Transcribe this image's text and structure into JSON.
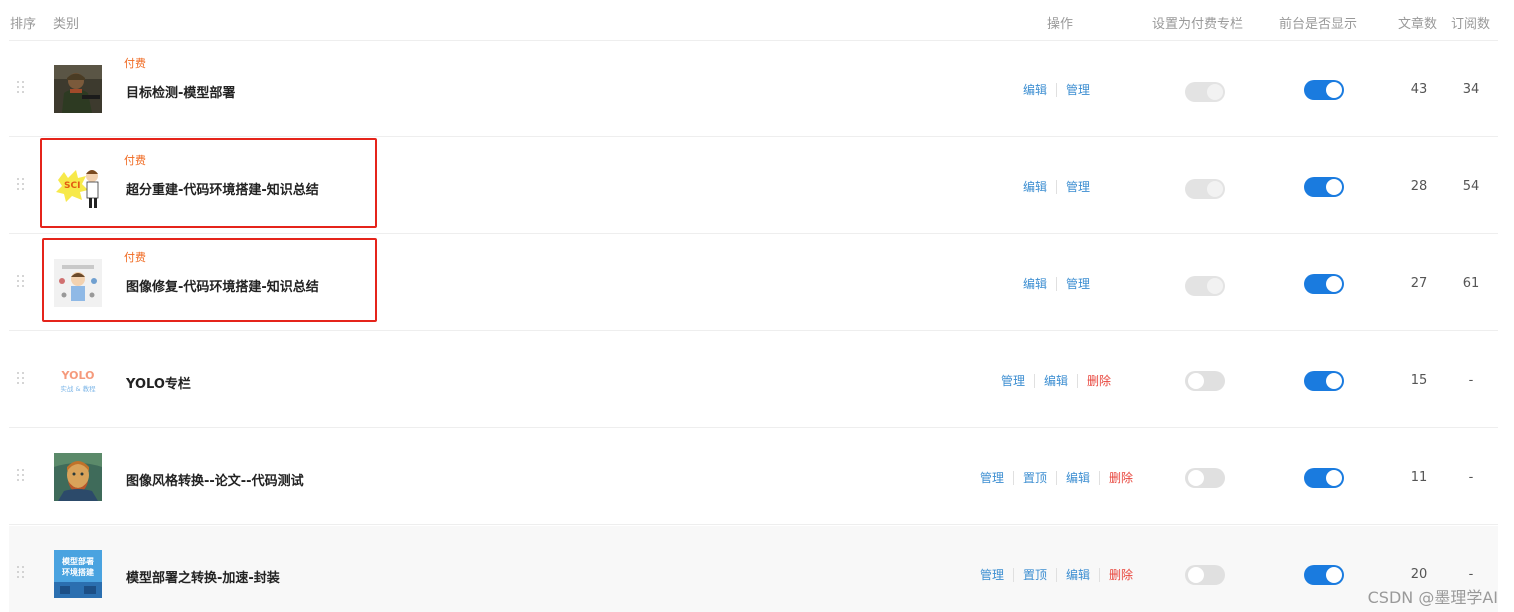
{
  "header": {
    "sort": "排序",
    "category": "类别",
    "ops": "操作",
    "set_paid": "设置为付费专栏",
    "show_front": "前台是否显示",
    "articles": "文章数",
    "subscribers": "订阅数"
  },
  "rows": [
    {
      "paid_label": "付费",
      "title": "目标检测-模型部署",
      "ops": [
        "编辑",
        "管理"
      ],
      "paid_toggle": "disabled-on",
      "show_toggle": "on",
      "articles": "43",
      "subscribers": "34",
      "thumb_icon": "soldier-photo-icon"
    },
    {
      "paid_label": "付费",
      "title": "超分重建-代码环境搭建-知识总结",
      "ops": [
        "编辑",
        "管理"
      ],
      "paid_toggle": "disabled-on",
      "show_toggle": "on",
      "articles": "28",
      "subscribers": "54",
      "thumb_icon": "sci-cartoon-icon",
      "thumb_text": "SCI"
    },
    {
      "paid_label": "付费",
      "title": "图像修复-代码环境搭建-知识总结",
      "ops": [
        "编辑",
        "管理"
      ],
      "paid_toggle": "disabled-on",
      "show_toggle": "on",
      "articles": "27",
      "subscribers": "61",
      "thumb_icon": "scientist-cartoon-icon"
    },
    {
      "paid_label": "",
      "title": "YOLO专栏",
      "ops": [
        "管理",
        "编辑",
        "删除"
      ],
      "paid_toggle": "off",
      "show_toggle": "on",
      "articles": "15",
      "subscribers": "-",
      "thumb_icon": "yolo-logo-icon",
      "thumb_text": "YOLO",
      "thumb_subtext": "实战 & 教程"
    },
    {
      "paid_label": "",
      "title": "图像风格转换--论文--代码测试",
      "ops": [
        "管理",
        "置顶",
        "编辑",
        "删除"
      ],
      "paid_toggle": "off",
      "show_toggle": "on",
      "articles": "11",
      "subscribers": "-",
      "thumb_icon": "van-gogh-portrait-icon"
    },
    {
      "paid_label": "",
      "title": "模型部署之转换-加速-封装",
      "ops": [
        "管理",
        "置顶",
        "编辑",
        "删除"
      ],
      "paid_toggle": "off",
      "show_toggle": "on",
      "articles": "20",
      "subscribers": "-",
      "thumb_icon": "deploy-cover-icon",
      "thumb_text": "模型部署",
      "thumb_subtext": "环境搭建"
    }
  ],
  "watermark": "CSDN @墨理学AI",
  "colors": {
    "accent": "#1a7bdf",
    "link": "#3c8ed1",
    "delete": "#e8453c",
    "paid": "#f06a21",
    "highlight_box": "#e5241b"
  }
}
